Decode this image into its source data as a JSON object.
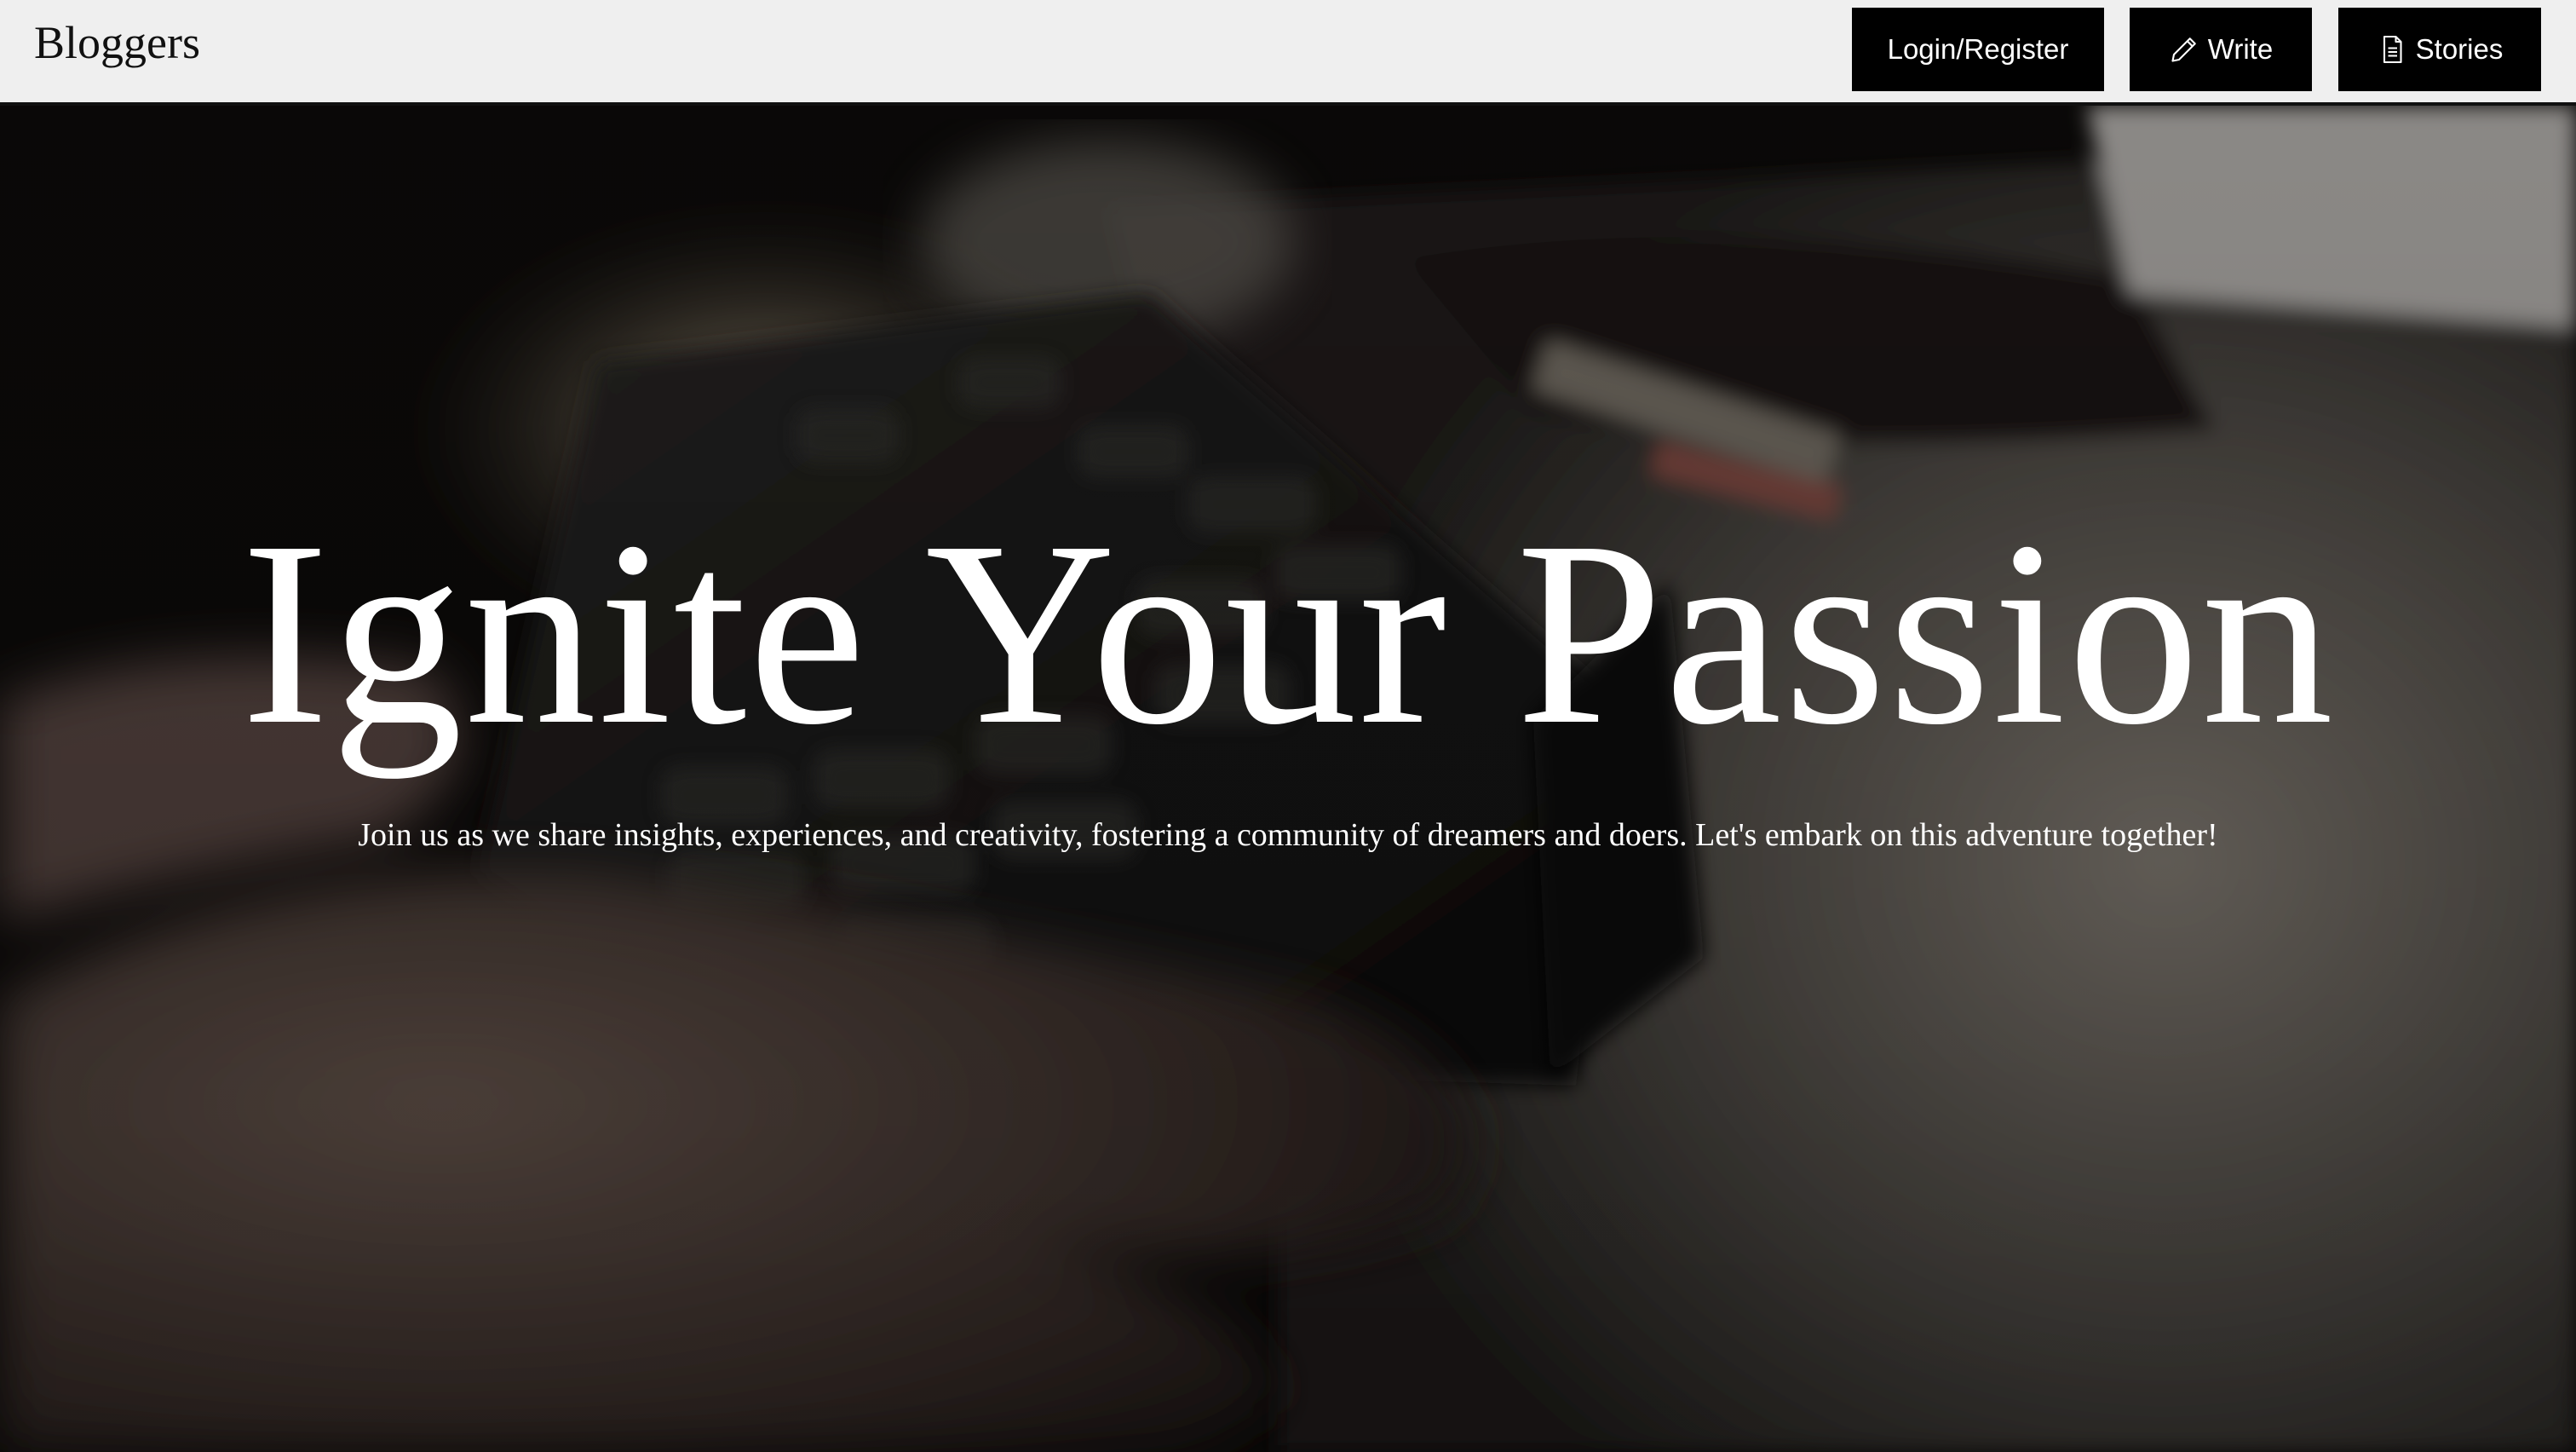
{
  "header": {
    "brand": "Bloggers",
    "nav": [
      {
        "label": "Login/Register",
        "icon": ""
      },
      {
        "label": "Write",
        "icon": "pencil-icon"
      },
      {
        "label": "Stories",
        "icon": "document-icon"
      }
    ]
  },
  "hero": {
    "title": "Ignite Your Passion",
    "subtitle": "Join us as we share insights, experiences, and creativity, fostering a community of dreamers and doers. Let's embark on this adventure together!",
    "background": "typewriter-photo"
  },
  "colors": {
    "header_bg": "#efefef",
    "button_bg": "#000000",
    "button_text": "#ffffff",
    "hero_text": "#ffffff"
  }
}
